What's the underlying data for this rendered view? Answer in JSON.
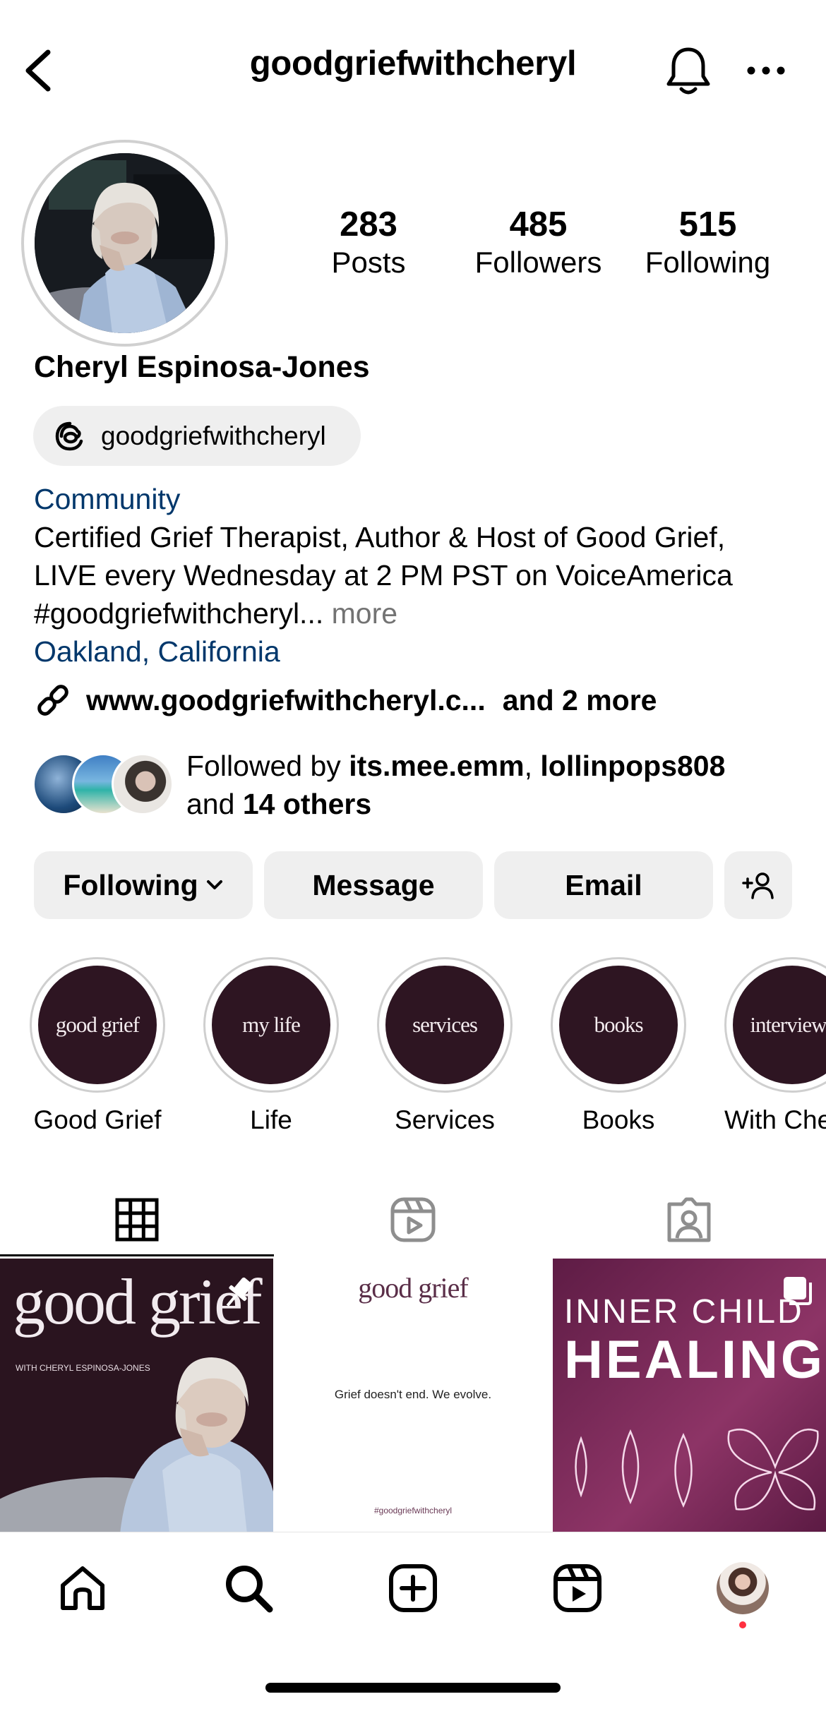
{
  "header": {
    "username": "goodgriefwithcheryl",
    "icons": [
      "chevron-left-icon",
      "bell-icon",
      "more-icon"
    ]
  },
  "profile": {
    "display_name": "Cheryl Espinosa-Jones",
    "stats": [
      {
        "value": "283",
        "label": "Posts"
      },
      {
        "value": "485",
        "label": "Followers"
      },
      {
        "value": "515",
        "label": "Following"
      }
    ],
    "threads_handle": "goodgriefwithcheryl",
    "category": "Community",
    "bio_lines": [
      "Certified Grief Therapist, Author & Host of Good Grief,",
      "LIVE every Wednesday at 2 PM PST on VoiceAmerica",
      "#goodgriefwithcheryl..."
    ],
    "bio_more": "more",
    "location": "Oakland, California",
    "link_text": "www.goodgriefwithcheryl.c...",
    "link_more": "and 2 more",
    "followed_by": {
      "prefix": "Followed by",
      "user1": "its.mee.emm",
      "sep": ",",
      "user2": "lollinpops808",
      "and_text": "and",
      "others": "14 others"
    }
  },
  "actions": {
    "following": "Following",
    "message": "Message",
    "email": "Email"
  },
  "highlights": [
    {
      "cover_text": "good grief",
      "label": "Good Grief"
    },
    {
      "cover_text": "my life",
      "label": "Life"
    },
    {
      "cover_text": "services",
      "label": "Services"
    },
    {
      "cover_text": "books",
      "label": "Books"
    },
    {
      "cover_text": "interviews",
      "label": "With Che"
    }
  ],
  "tabs": [
    "grid-icon",
    "reels-icon",
    "tagged-icon"
  ],
  "posts": [
    {
      "title": "good grief",
      "subtitle": "WITH CHERYL ESPINOSA-JONES"
    },
    {
      "title": "good grief",
      "text": "Grief doesn't end. We evolve.",
      "tag": "#goodgriefwithcheryl"
    },
    {
      "line1": "INNER CHILD",
      "line2": "HEALING"
    }
  ],
  "colors": {
    "link_blue": "#00376b",
    "highlight_bg": "#2e1522",
    "notification_dot": "#ff3040"
  }
}
